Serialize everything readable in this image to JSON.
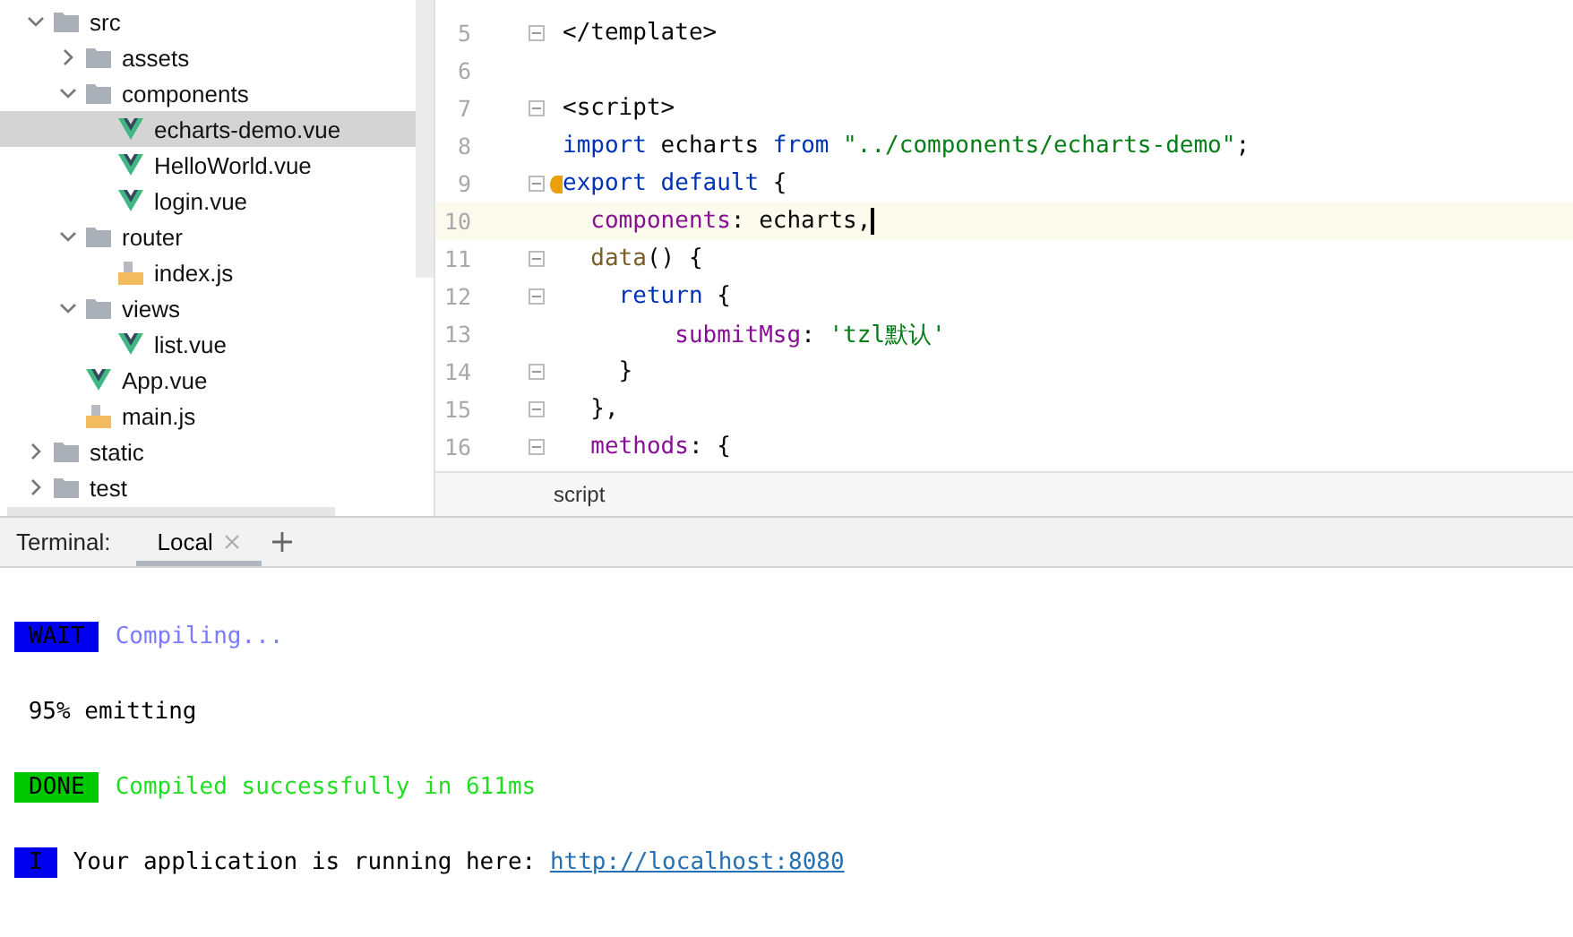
{
  "project_tree": [
    {
      "label": "src",
      "kind": "folder",
      "expanded": true,
      "selected": false,
      "children": [
        {
          "label": "assets",
          "kind": "folder",
          "expanded": false,
          "selected": false
        },
        {
          "label": "components",
          "kind": "folder",
          "expanded": true,
          "selected": false,
          "children": [
            {
              "label": "echarts-demo.vue",
              "kind": "vue",
              "selected": true
            },
            {
              "label": "HelloWorld.vue",
              "kind": "vue",
              "selected": false
            },
            {
              "label": "login.vue",
              "kind": "vue",
              "selected": false
            }
          ]
        },
        {
          "label": "router",
          "kind": "folder",
          "expanded": true,
          "selected": false,
          "children": [
            {
              "label": "index.js",
              "kind": "js",
              "selected": false
            }
          ]
        },
        {
          "label": "views",
          "kind": "folder",
          "expanded": true,
          "selected": false,
          "children": [
            {
              "label": "list.vue",
              "kind": "vue",
              "selected": false
            }
          ]
        },
        {
          "label": "App.vue",
          "kind": "vue",
          "selected": false
        },
        {
          "label": "main.js",
          "kind": "js",
          "selected": false
        }
      ]
    },
    {
      "label": "static",
      "kind": "folder",
      "expanded": false,
      "selected": false
    },
    {
      "label": "test",
      "kind": "folder",
      "expanded": false,
      "selected": false
    }
  ],
  "editor": {
    "lines": [
      {
        "number": "5",
        "fold": true,
        "current": false,
        "tokens": [
          {
            "kind": "plain",
            "text": "</template>"
          }
        ]
      },
      {
        "number": "6",
        "fold": false,
        "current": false
      },
      {
        "number": "7",
        "fold": true,
        "current": false,
        "tokens": [
          {
            "kind": "plain",
            "text": "<script>"
          }
        ]
      },
      {
        "number": "8",
        "fold": false,
        "current": false,
        "tokens": [
          {
            "kind": "keyword",
            "text": "import"
          },
          {
            "kind": "plain",
            "text": " echarts "
          },
          {
            "kind": "keyword",
            "text": "from"
          },
          {
            "kind": "string",
            "text": " \"../components/echarts-demo\""
          },
          {
            "kind": "plain",
            "text": ";"
          }
        ]
      },
      {
        "number": "9",
        "fold": true,
        "current": false,
        "bulb": true,
        "tokens": [
          {
            "kind": "keyword",
            "text": "export default"
          },
          {
            "kind": "plain",
            "text": " {"
          }
        ]
      },
      {
        "number": "10",
        "fold": false,
        "current": true,
        "tokens": [
          {
            "kind": "prop",
            "text": "  components"
          },
          {
            "kind": "plain",
            "text": ": echarts,"
          }
        ]
      },
      {
        "number": "11",
        "fold": true,
        "current": false,
        "tokens": [
          {
            "kind": "func",
            "text": "  data"
          },
          {
            "kind": "plain",
            "text": "() {"
          }
        ]
      },
      {
        "number": "12",
        "fold": true,
        "current": false,
        "tokens": [
          {
            "kind": "keyword",
            "text": "    return"
          },
          {
            "kind": "plain",
            "text": " {"
          }
        ]
      },
      {
        "number": "13",
        "fold": false,
        "current": false,
        "tokens": [
          {
            "kind": "prop",
            "text": "        submitMsg"
          },
          {
            "kind": "plain",
            "text": ": "
          },
          {
            "kind": "string",
            "text": "'tzl默认'"
          }
        ]
      },
      {
        "number": "14",
        "fold": true,
        "current": false,
        "tokens": [
          {
            "kind": "plain",
            "text": "    }"
          }
        ]
      },
      {
        "number": "15",
        "fold": true,
        "current": false,
        "tokens": [
          {
            "kind": "plain",
            "text": "  },"
          }
        ]
      },
      {
        "number": "16",
        "fold": true,
        "current": false,
        "tokens": [
          {
            "kind": "prop",
            "text": "  methods"
          },
          {
            "kind": "plain",
            "text": ": {"
          }
        ]
      }
    ],
    "breadcrumb": "script"
  },
  "terminal": {
    "label": "Terminal:",
    "tabs": [
      {
        "label": "Local",
        "selected": true
      }
    ],
    "lines": [
      {
        "badge": {
          "text": "WAIT",
          "color": "#0000ee"
        },
        "text": "Compiling...",
        "color": "#7b7bff"
      },
      {
        "text": " 95% emitting",
        "color": "#000000"
      },
      {
        "badge": {
          "text": "DONE",
          "color": "#00c800"
        },
        "text": "Compiled successfully in 611ms",
        "color": "#22dd22"
      },
      {
        "badge": {
          "text": "I",
          "color": "#0000ee"
        },
        "text": "Your application is running here: ",
        "color": "#000000",
        "link": "http://localhost:8080"
      }
    ]
  }
}
